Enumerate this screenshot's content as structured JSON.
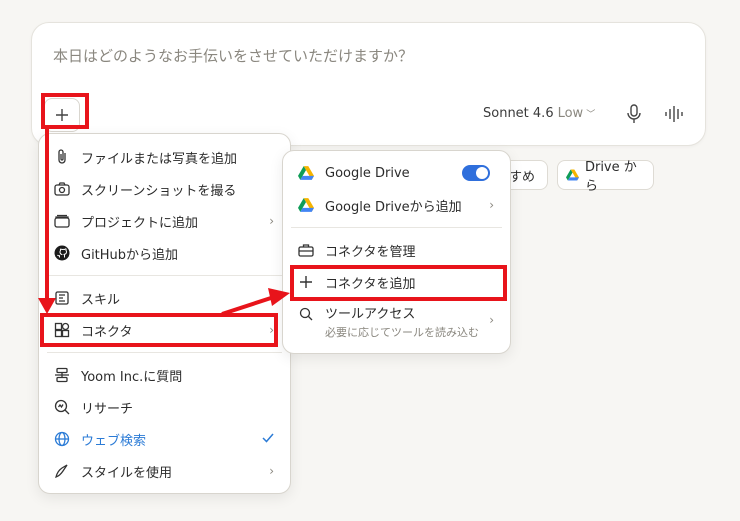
{
  "composer": {
    "placeholder": "本日はどのようなお手伝いをさせていただけますか？",
    "model_name": "Sonnet 4.6",
    "effort": "Low"
  },
  "chips": {
    "left_partial": "すめ",
    "drive_label": "Drive から"
  },
  "menu": {
    "items": [
      {
        "label": "ファイルまたは写真を追加",
        "icon": "paperclip-icon"
      },
      {
        "label": "スクリーンショットを撮る",
        "icon": "camera-icon"
      },
      {
        "label": "プロジェクトに追加",
        "icon": "folder-icon"
      },
      {
        "label": "GitHubから追加",
        "icon": "github-icon"
      },
      {
        "label": "スキル",
        "icon": "skill-icon"
      },
      {
        "label": "コネクタ",
        "icon": "connector-icon"
      },
      {
        "label": "Yoom Inc.に質問",
        "icon": "org-icon"
      },
      {
        "label": "リサーチ",
        "icon": "research-icon"
      },
      {
        "label": "ウェブ検索",
        "icon": "globe-icon"
      },
      {
        "label": "スタイルを使用",
        "icon": "style-icon"
      }
    ]
  },
  "submenu": {
    "items": [
      {
        "label": "Google Drive"
      },
      {
        "label": "Google Driveから追加"
      },
      {
        "label": "コネクタを管理"
      },
      {
        "label": "コネクタを追加"
      },
      {
        "label": "ツールアクセス",
        "sub": "必要に応じてツールを読み込む"
      }
    ]
  },
  "colors": {
    "highlight": "#e8141b",
    "toggle_on": "#2f6fdc",
    "web_search": "#2b7bd6"
  }
}
